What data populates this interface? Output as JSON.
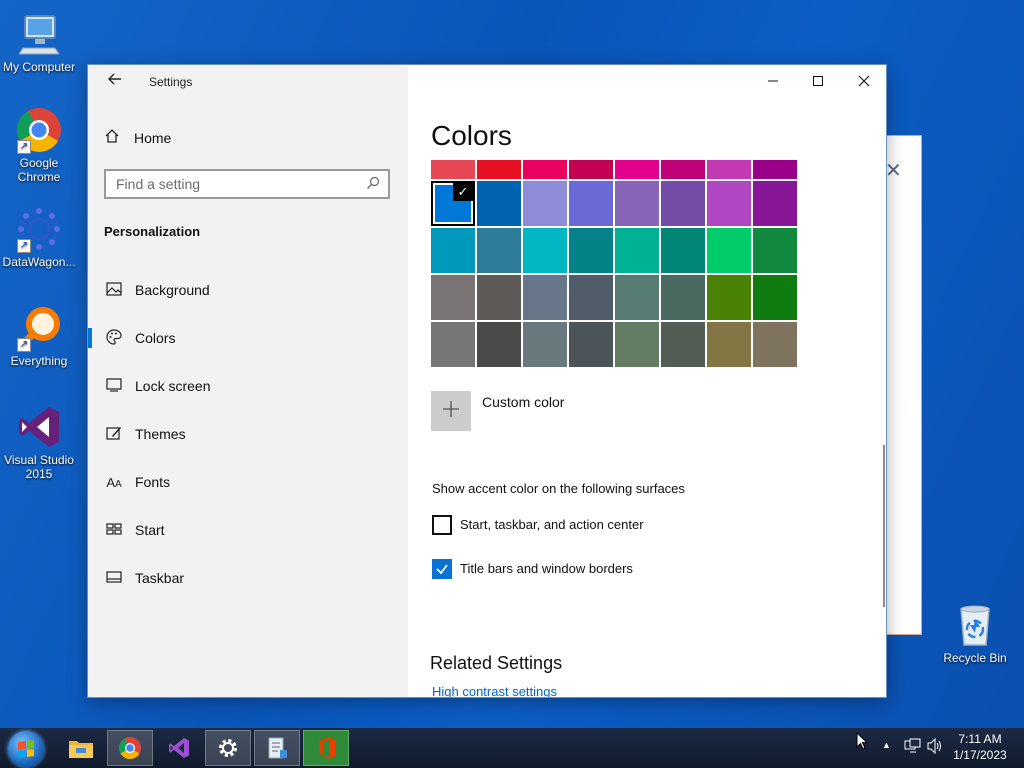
{
  "desktop": {
    "icons": [
      {
        "label": "My Computer"
      },
      {
        "label": "Google Chrome"
      },
      {
        "label": "DataWagon..."
      },
      {
        "label": "Everything"
      },
      {
        "label": "Visual Studio 2015"
      },
      {
        "label": "Recycle Bin"
      }
    ]
  },
  "window": {
    "title": "Settings",
    "home_label": "Home",
    "search_placeholder": "Find a setting",
    "section_label": "Personalization",
    "nav": [
      {
        "label": "Background",
        "icon": "picture-icon"
      },
      {
        "label": "Colors",
        "icon": "palette-icon",
        "active": true
      },
      {
        "label": "Lock screen",
        "icon": "lock-screen-icon"
      },
      {
        "label": "Themes",
        "icon": "brush-icon"
      },
      {
        "label": "Fonts",
        "icon": "fonts-icon"
      },
      {
        "label": "Start",
        "icon": "start-grid-icon"
      },
      {
        "label": "Taskbar",
        "icon": "taskbar-icon"
      }
    ]
  },
  "content": {
    "title": "Colors",
    "swatches": [
      [
        "#e74856",
        "#e81123",
        "#ea005e",
        "#c30052",
        "#e3008c",
        "#bf0077",
        "#c239b3",
        "#9a0089"
      ],
      [
        "#0078d7",
        "#0063b1",
        "#8e8cd8",
        "#6b69d6",
        "#8764b8",
        "#744da9",
        "#b146c2",
        "#881798"
      ],
      [
        "#0099bc",
        "#2d7d9a",
        "#00b7c3",
        "#038387",
        "#00b294",
        "#018574",
        "#00cc6a",
        "#10893e"
      ],
      [
        "#7a7574",
        "#5d5a58",
        "#68768a",
        "#515c6b",
        "#567c73",
        "#486860",
        "#498205",
        "#107c10"
      ],
      [
        "#767676",
        "#4c4a48",
        "#69797e",
        "#4a5459",
        "#647c64",
        "#525e54",
        "#847545",
        "#7e735f"
      ]
    ],
    "selected_swatch": [
      1,
      0
    ],
    "custom_color_label": "Custom color",
    "surfaces_heading": "Show accent color on the following surfaces",
    "checkbox_start_label": "Start, taskbar, and action center",
    "checkbox_start_checked": false,
    "checkbox_title_label": "Title bars and window borders",
    "checkbox_title_checked": true,
    "related_heading": "Related Settings",
    "related_link": "High contrast settings"
  },
  "taskbar": {
    "time": "7:11 AM",
    "date": "1/17/2023"
  }
}
